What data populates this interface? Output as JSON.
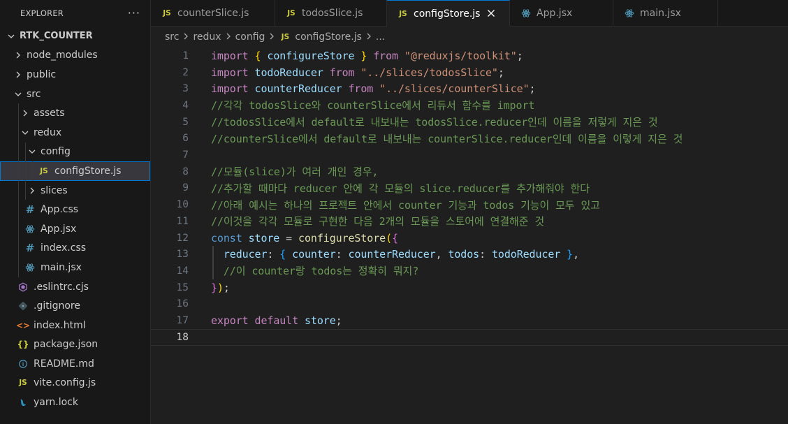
{
  "explorer": {
    "title": "EXPLORER",
    "more_label": "···",
    "items": [
      {
        "label": "RTK_COUNTER",
        "depth": 0,
        "chevron": "v",
        "icon": "",
        "root": true
      },
      {
        "label": "node_modules",
        "depth": 1,
        "chevron": ">",
        "icon": ""
      },
      {
        "label": "public",
        "depth": 1,
        "chevron": ">",
        "icon": ""
      },
      {
        "label": "src",
        "depth": 1,
        "chevron": "v",
        "icon": ""
      },
      {
        "label": "assets",
        "depth": 2,
        "chevron": ">",
        "icon": ""
      },
      {
        "label": "redux",
        "depth": 2,
        "chevron": "v",
        "icon": ""
      },
      {
        "label": "config",
        "depth": 3,
        "chevron": "v",
        "icon": ""
      },
      {
        "label": "configStore.js",
        "depth": 4,
        "chevron": "",
        "icon": "js",
        "selected": true
      },
      {
        "label": "slices",
        "depth": 3,
        "chevron": ">",
        "icon": ""
      },
      {
        "label": "App.css",
        "depth": 2,
        "chevron": "",
        "icon": "css"
      },
      {
        "label": "App.jsx",
        "depth": 2,
        "chevron": "",
        "icon": "react"
      },
      {
        "label": "index.css",
        "depth": 2,
        "chevron": "",
        "icon": "css"
      },
      {
        "label": "main.jsx",
        "depth": 2,
        "chevron": "",
        "icon": "react"
      },
      {
        "label": ".eslintrc.cjs",
        "depth": 1,
        "chevron": "",
        "icon": "eslint"
      },
      {
        "label": ".gitignore",
        "depth": 1,
        "chevron": "",
        "icon": "git"
      },
      {
        "label": "index.html",
        "depth": 1,
        "chevron": "",
        "icon": "html"
      },
      {
        "label": "package.json",
        "depth": 1,
        "chevron": "",
        "icon": "json"
      },
      {
        "label": "README.md",
        "depth": 1,
        "chevron": "",
        "icon": "info"
      },
      {
        "label": "vite.config.js",
        "depth": 1,
        "chevron": "",
        "icon": "js"
      },
      {
        "label": "yarn.lock",
        "depth": 1,
        "chevron": "",
        "icon": "yarn"
      }
    ]
  },
  "tabs": [
    {
      "label": "counterSlice.js",
      "icon": "js",
      "active": false
    },
    {
      "label": "todosSlice.js",
      "icon": "js",
      "active": false
    },
    {
      "label": "configStore.js",
      "icon": "js",
      "active": true
    },
    {
      "label": "App.jsx",
      "icon": "react",
      "active": false
    },
    {
      "label": "main.jsx",
      "icon": "react",
      "active": false
    }
  ],
  "breadcrumb": [
    "src",
    "redux",
    "config",
    "configStore.js",
    "..."
  ],
  "editor": {
    "active_line": 18,
    "lines": [
      [
        [
          "import",
          "imp"
        ],
        [
          " ",
          ""
        ],
        [
          "{",
          "br1"
        ],
        [
          " configureStore ",
          "var"
        ],
        [
          "}",
          "br1"
        ],
        [
          " ",
          ""
        ],
        [
          "from",
          "imp"
        ],
        [
          " ",
          ""
        ],
        [
          "\"@reduxjs/toolkit\"",
          "str"
        ],
        [
          ";",
          "punc"
        ]
      ],
      [
        [
          "import",
          "imp"
        ],
        [
          " todoReducer ",
          "var"
        ],
        [
          "from",
          "imp"
        ],
        [
          " ",
          ""
        ],
        [
          "\"../slices/todosSlice\"",
          "str"
        ],
        [
          ";",
          "punc"
        ]
      ],
      [
        [
          "import",
          "imp"
        ],
        [
          " counterReducer ",
          "var"
        ],
        [
          "from",
          "imp"
        ],
        [
          " ",
          ""
        ],
        [
          "\"../slices/counterSlice\"",
          "str"
        ],
        [
          ";",
          "punc"
        ]
      ],
      [
        [
          "//각각 todosSlice와 counterSlice에서 리듀서 함수를 import",
          "cm"
        ]
      ],
      [
        [
          "//todosSlice에서 default로 내보내는 todosSlice.reducer인데 이름을 저렇게 지은 것",
          "cm"
        ]
      ],
      [
        [
          "//counterSlice에서 default로 내보내는 counterSlice.reducer인데 이름을 이렇게 지은 것",
          "cm"
        ]
      ],
      [],
      [
        [
          "//모듈(slice)가 여러 개인 경우,",
          "cm"
        ]
      ],
      [
        [
          "//추가할 때마다 reducer 안에 각 모듈의 slice.reducer를 추가해줘야 한다",
          "cm"
        ]
      ],
      [
        [
          "//아래 예시는 하나의 프로젝트 안에서 counter 기능과 todos 기능이 모두 있고",
          "cm"
        ]
      ],
      [
        [
          "//이것을 각각 모듈로 구현한 다음 2개의 모듈을 스토어에 연결해준 것",
          "cm"
        ]
      ],
      [
        [
          "const",
          "kw"
        ],
        [
          " store ",
          "var"
        ],
        [
          "=",
          "punc"
        ],
        [
          " ",
          ""
        ],
        [
          "configureStore",
          "fn"
        ],
        [
          "(",
          "br1"
        ],
        [
          "{",
          "br2"
        ]
      ],
      [
        [
          "  reducer",
          "var"
        ],
        [
          ": ",
          "punc"
        ],
        [
          "{",
          "br3"
        ],
        [
          " counter",
          "var"
        ],
        [
          ": ",
          "punc"
        ],
        [
          "counterReducer",
          "var"
        ],
        [
          ", ",
          "punc"
        ],
        [
          "todos",
          "var"
        ],
        [
          ": ",
          "punc"
        ],
        [
          "todoReducer",
          "var"
        ],
        [
          " ",
          ""
        ],
        [
          "}",
          "br3"
        ],
        [
          ",",
          "punc"
        ]
      ],
      [
        [
          "  //이 counter랑 todos는 정확히 뭐지?",
          "cm"
        ]
      ],
      [
        [
          "}",
          "br2"
        ],
        [
          ")",
          "br1"
        ],
        [
          ";",
          "punc"
        ]
      ],
      [],
      [
        [
          "export",
          "imp"
        ],
        [
          " ",
          ""
        ],
        [
          "default",
          "imp"
        ],
        [
          " store",
          "var"
        ],
        [
          ";",
          "punc"
        ]
      ],
      []
    ]
  }
}
